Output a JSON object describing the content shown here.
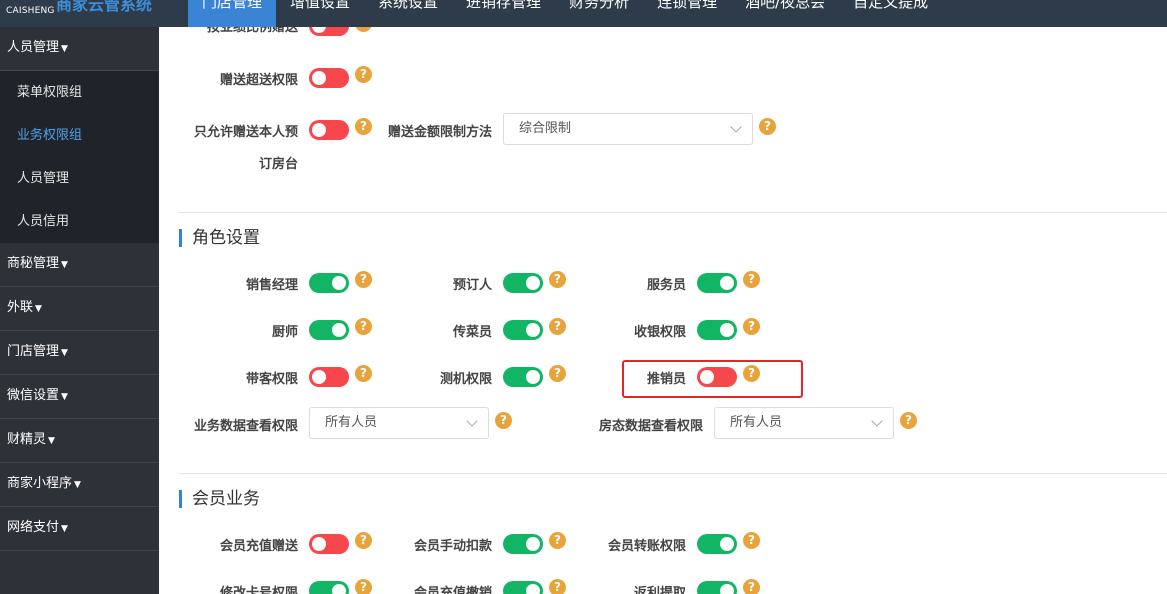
{
  "header": {
    "brand_small": "CAISHENG",
    "brand_title": "商家云管系统",
    "nav": [
      "门店管理",
      "增值设置",
      "系统设置",
      "进销存管理",
      "财务分析",
      "连锁管理",
      "酒吧/夜总会",
      "自定义提成"
    ],
    "active_nav": "门店管理"
  },
  "sidebar": {
    "groups": [
      "人员管理",
      "商秘管理",
      "外联",
      "门店管理",
      "微信设置",
      "财精灵",
      "商家小程序",
      "网络支付"
    ],
    "sub_items": [
      "菜单权限组",
      "业务权限组",
      "人员管理",
      "人员信用"
    ],
    "active_sub": "业务权限组"
  },
  "perm_top": {
    "partial_label": "按业绩比例赠送",
    "gift_overdelivery": {
      "label": "赠送超送权限",
      "on": false
    },
    "gift_self_booking": {
      "label_line1": "只允许赠送本人预",
      "label_line2": "订房台",
      "on": false
    },
    "gift_amount_limit": {
      "label": "赠送金额限制方法",
      "value": "综合限制"
    }
  },
  "roles": {
    "title": "角色设置",
    "toggles": [
      {
        "label": "销售经理",
        "on": true
      },
      {
        "label": "预订人",
        "on": true
      },
      {
        "label": "服务员",
        "on": true
      },
      {
        "label": "厨师",
        "on": true
      },
      {
        "label": "传菜员",
        "on": true
      },
      {
        "label": "收银权限",
        "on": true
      },
      {
        "label": "带客权限",
        "on": false
      },
      {
        "label": "测机权限",
        "on": true
      },
      {
        "label": "推销员",
        "on": false
      }
    ],
    "biz_data_view": {
      "label": "业务数据查看权限",
      "value": "所有人员"
    },
    "room_data_view": {
      "label": "房态数据查看权限",
      "value": "所有人员"
    }
  },
  "member": {
    "title": "会员业务",
    "toggles": [
      {
        "label": "会员充值赠送",
        "on": false
      },
      {
        "label": "会员手动扣款",
        "on": true
      },
      {
        "label": "会员转账权限",
        "on": true
      },
      {
        "label": "修改卡号权限",
        "on": true
      },
      {
        "label": "会员充值撤销",
        "on": true
      },
      {
        "label": "返利提取",
        "on": true
      }
    ]
  },
  "help_glyph": "?",
  "colors": {
    "toggle_on": "#12b564",
    "toggle_off": "#f5474c",
    "help": "#e8a33b",
    "accent": "#3a84d6",
    "highlight": "#e8242a"
  }
}
